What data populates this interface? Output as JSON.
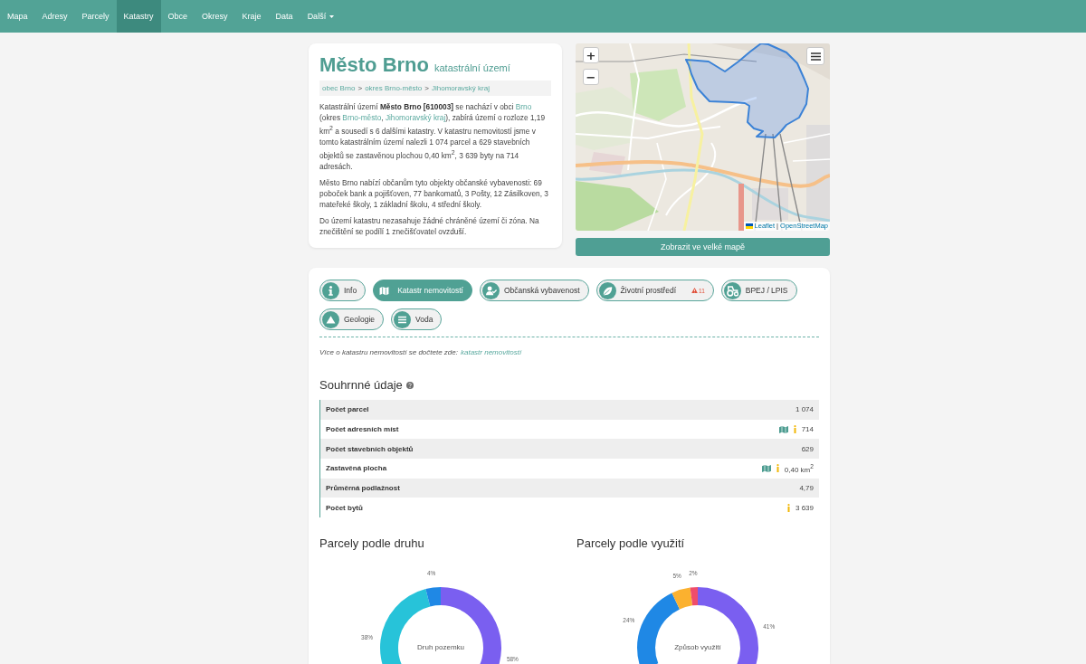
{
  "nav": {
    "items": [
      {
        "label": "Mapa",
        "selected": false,
        "dropdown": false
      },
      {
        "label": "Adresy",
        "selected": false,
        "dropdown": false
      },
      {
        "label": "Parcely",
        "selected": false,
        "dropdown": false
      },
      {
        "label": "Katastry",
        "selected": true,
        "dropdown": false
      },
      {
        "label": "Obce",
        "selected": false,
        "dropdown": false
      },
      {
        "label": "Okresy",
        "selected": false,
        "dropdown": false
      },
      {
        "label": "Kraje",
        "selected": false,
        "dropdown": false
      },
      {
        "label": "Data",
        "selected": false,
        "dropdown": false
      },
      {
        "label": "Další",
        "selected": false,
        "dropdown": true
      }
    ]
  },
  "info_card": {
    "title": "Město Brno",
    "subtitle": "katastrální území",
    "breadcrumb": [
      {
        "label": "obec Brno"
      },
      {
        "separator": ">",
        "label": "okres Brno-město"
      },
      {
        "separator": ">",
        "label": "Jihomoravský kraj"
      }
    ],
    "paragraphs": [
      [
        {
          "kind": "text",
          "text": "Katastrální území **Město Brno [610003]** se nachází v obci "
        },
        {
          "kind": "link",
          "text": "Brno"
        },
        {
          "kind": "text",
          "text": " (okres "
        },
        {
          "kind": "link",
          "text": "Brno-město"
        },
        {
          "kind": "text",
          "text": ", "
        },
        {
          "kind": "link",
          "text": "Jihomoravský kraj"
        },
        {
          "kind": "text",
          "text": "), zabírá území o rozloze 1,19 km$^{2}$ a sousedí s 6 dalšími katastry. V katastru nemovitostí jsme v tomto katastrálním území nalezli 1 074 parcel a 629 stavebních objektů se zastavěnou plochou 0,40 km$^{2}$, 3 639 byty na 714 adresách."
        }
      ],
      [
        {
          "kind": "text",
          "text": "Město Brno nabízí občanům tyto objekty občanské vybavenosti: 69 poboček bank a pojišťoven, 77 bankomatů, 3 Pošty, 12 Zásilkoven, 3 mateřeké školy, 1 základní školu, 4 střední školy."
        }
      ],
      [
        {
          "kind": "text",
          "text": "Do území katastru nezasahuje žádné chráněné území či zóna. Na znečištění se podílí 1 znečišťovatel ovzduší."
        }
      ]
    ]
  },
  "map": {
    "zoom_in": "+",
    "zoom_out": "−",
    "attribution": [
      {
        "label": "Leaflet"
      },
      {
        "separator": "|",
        "label": "OpenStreetMap"
      }
    ],
    "button": "Zobrazit ve velké mapě"
  },
  "tabs": [
    {
      "label": "Info",
      "selected": false
    },
    {
      "label": "Katastr nemovitostí",
      "selected": true
    },
    {
      "label": "Občanská vybavenost",
      "selected": false
    },
    {
      "label": "Životní prostředí",
      "selected": false,
      "warning_count": "11"
    },
    {
      "label": "BPEJ / LPIS",
      "selected": false
    },
    {
      "label": "Geologie",
      "selected": false
    },
    {
      "label": "Voda",
      "selected": false
    }
  ],
  "note": {
    "text": "Více o katastru nemovitostí se dočtete zde:",
    "link": "katastr nemovitostí"
  },
  "summary": {
    "heading": "Souhrnné údaje",
    "rows": [
      {
        "label": "Počet parcel",
        "value": "1 074",
        "map_link": false,
        "info": false
      },
      {
        "label": "Počet adresních míst",
        "value": "714",
        "map_link": true,
        "info": true
      },
      {
        "label": "Počet stavebních objektů",
        "value": "629",
        "map_link": false,
        "info": false
      },
      {
        "label": "Zastavěná plocha",
        "value": "0,40 km$^{2}$",
        "map_link": true,
        "info": true
      },
      {
        "label": "Průměrná podlažnost",
        "value": "4,79",
        "map_link": false,
        "info": false
      },
      {
        "label": "Počet bytů",
        "value": "3 639",
        "map_link": false,
        "info": true
      }
    ]
  },
  "charts": [
    {
      "heading": "Parcely podle druhu",
      "center_label": "Druh pozemku",
      "chart_data": {
        "type": "donut",
        "values": [
          58,
          38,
          4
        ],
        "value_labels": [
          "58%",
          "38%",
          "4%"
        ],
        "colors": [
          "#7a5ff0",
          "#27c3d9",
          "#1f88e5"
        ]
      }
    },
    {
      "heading": "Parcely podle využití",
      "center_label": "Způsob využití",
      "chart_data": {
        "type": "donut",
        "values": [
          41,
          null,
          24,
          5,
          2
        ],
        "value_labels": [
          "41%",
          null,
          "24%",
          "5%",
          "2%"
        ],
        "colors": [
          "#7a5ff0",
          null,
          "#1f88e5",
          "#fbb12f",
          "#ef4d6b"
        ]
      }
    }
  ]
}
